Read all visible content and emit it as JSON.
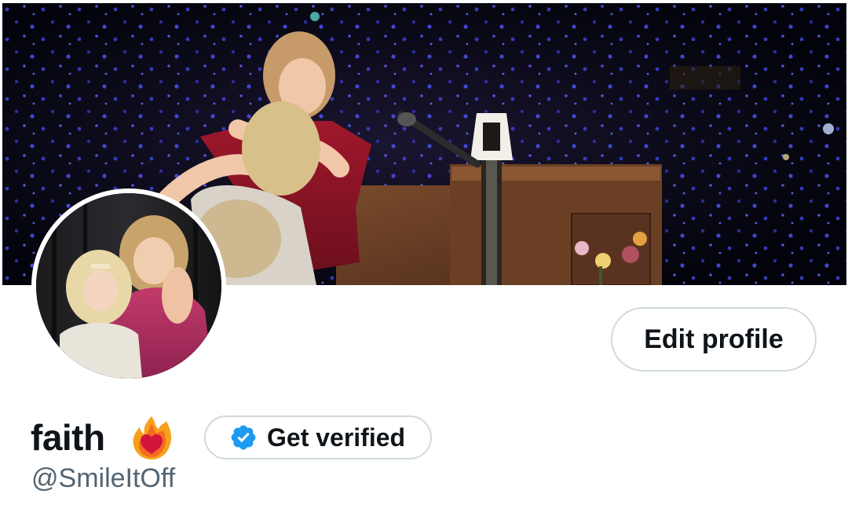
{
  "profile": {
    "display_name": "faith",
    "name_emoji": "heart-on-fire-emoji",
    "handle": "@SmileItOff"
  },
  "actions": {
    "edit_profile_label": "Edit profile",
    "get_verified_label": "Get verified"
  },
  "icons": {
    "verified_badge": "verified-badge-icon",
    "emoji": "heart-on-fire-icon"
  },
  "colors": {
    "text_primary": "#0f1419",
    "text_secondary": "#536471",
    "border": "#cfd9de",
    "verified_blue": "#1d9bf0"
  }
}
